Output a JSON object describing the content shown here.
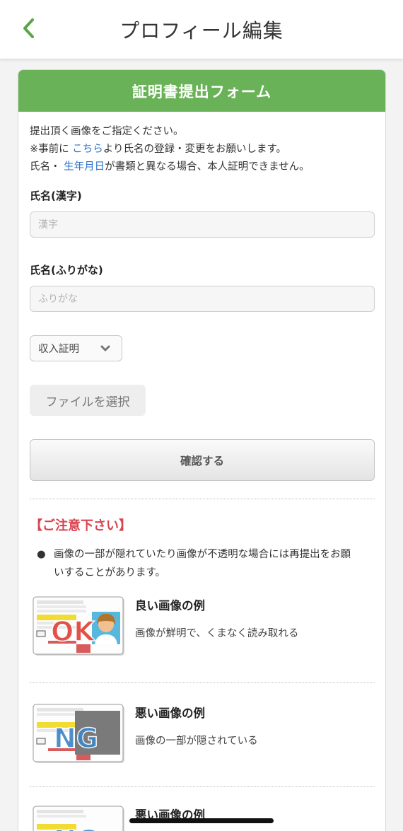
{
  "header": {
    "title": "プロフィール編集",
    "back_icon": "chevron-left-icon"
  },
  "form": {
    "title": "証明書提出フォーム",
    "intro": {
      "line1": "提出頂く画像をご指定ください。",
      "line2_prefix": "※事前に",
      "line2_link": "こちら",
      "line2_suffix": "より氏名の登録・変更をお願いします。",
      "line3_prefix": "氏名・",
      "line3_link": "生年月日",
      "line3_suffix": "が書類と異なる場合、本人証明できません。"
    },
    "name_kanji": {
      "label": "氏名(漢字)",
      "placeholder": "漢字",
      "value": ""
    },
    "name_kana": {
      "label": "氏名(ふりがな)",
      "placeholder": "ふりがな",
      "value": ""
    },
    "doc_type": {
      "selected": "収入証明"
    },
    "file_button": "ファイルを選択",
    "confirm_button": "確認する"
  },
  "notice": {
    "title": "【ご注意下さい】",
    "items": [
      {
        "line1": "画像の一部が隠れていたり画像が不透明な場合には再提出をお願",
        "line2": "いすることがあります。"
      }
    ]
  },
  "examples": [
    {
      "title": "良い画像の例",
      "desc": "画像が鮮明で、くまなく読み取れる",
      "badge": "OK"
    },
    {
      "title": "悪い画像の例",
      "desc": "画像の一部が隠されている",
      "badge": "NG"
    },
    {
      "title": "悪い画像の例",
      "desc": "",
      "badge": "NG"
    }
  ],
  "colors": {
    "accent_green": "#6ab258",
    "link_blue": "#2a72c9",
    "warning_red": "#d8434f"
  }
}
